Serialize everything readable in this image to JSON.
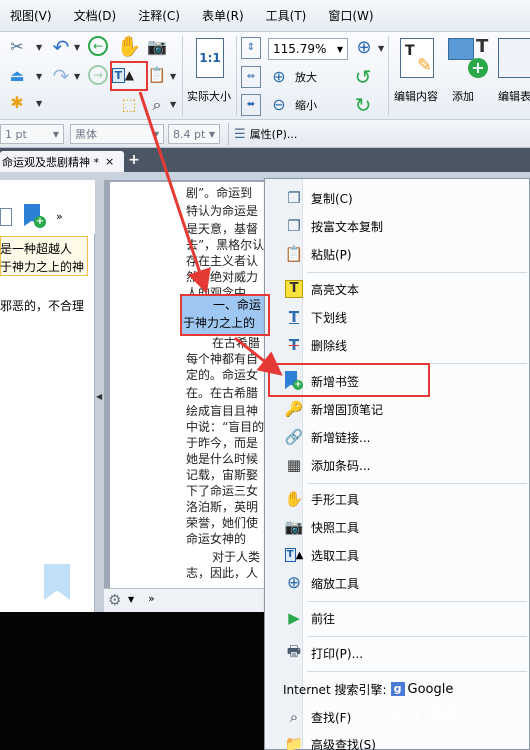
{
  "menubar": {
    "items": [
      "视图(V)",
      "文档(D)",
      "注释(C)",
      "表单(R)",
      "工具(T)",
      "窗口(W)"
    ]
  },
  "ribbon": {
    "actual_size_label": "实际大小",
    "zoom_value": "115.79%",
    "zoom_in_label": "放大",
    "zoom_out_label": "缩小",
    "edit_content_label": "编辑内容",
    "add_label": "添加",
    "edit_form_label": "编辑表",
    "actual_size_icon_text": "1:1"
  },
  "fontbar": {
    "size1": "1 pt",
    "font_name": "黑体",
    "size2": "8.4 pt",
    "properties_label": "属性(P)..."
  },
  "tab": {
    "title": "命运观及悲剧精神 *",
    "close": "×",
    "new": "+"
  },
  "bookmarks": {
    "line1": "是一种超越人",
    "line2": "于神力之上的神",
    "line3": "邪恶的，不合理"
  },
  "document": {
    "lines_top": [
      "剧”。命运到",
      "特认为命运是",
      "是天意，基督",
      "去”，黑格尔认",
      "存在主义者认",
      "然的绝对威力",
      "人的观念中。"
    ],
    "highlight": [
      "一、命运",
      "于神力之上的"
    ],
    "lines_bottom": [
      "在古希腊",
      "每个神都有自",
      "定的。命运女",
      "在。在古希腊",
      "绘成盲目且神",
      "中说：“盲目的",
      "于昨今，而是",
      "她是什么时候",
      "记载，宙斯娶",
      "下了命运三女",
      "洛泊斯，英明",
      "荣誉，她们使",
      "命运女神的",
      "对于人类",
      "志，因此，人"
    ]
  },
  "context_menu": {
    "items": [
      {
        "label": "复制(C)",
        "icon": "copy-icon"
      },
      {
        "label": "按富文本复制",
        "icon": "rich-copy-icon"
      },
      {
        "label": "粘贴(P)",
        "icon": "paste-icon"
      },
      {
        "label": "高亮文本",
        "icon": "highlight-icon"
      },
      {
        "label": "下划线",
        "icon": "underline-icon"
      },
      {
        "label": "删除线",
        "icon": "strikeout-icon"
      },
      {
        "label": "新增书签",
        "icon": "add-bookmark-icon"
      },
      {
        "label": "新增固顶笔记",
        "icon": "pin-note-icon"
      },
      {
        "label": "新增链接...",
        "icon": "add-link-icon"
      },
      {
        "label": "添加条码...",
        "icon": "barcode-icon"
      },
      {
        "label": "手形工具",
        "icon": "hand-icon"
      },
      {
        "label": "快照工具",
        "icon": "camera-icon"
      },
      {
        "label": "选取工具",
        "icon": "select-icon"
      },
      {
        "label": "缩放工具",
        "icon": "zoom-icon"
      },
      {
        "label": "前往",
        "icon": "goto-icon"
      },
      {
        "label": "打印(P)...",
        "icon": "printer-icon"
      },
      {
        "label": "查找(F)",
        "icon": "find-icon"
      },
      {
        "label": "高级查找(S)",
        "icon": "advanced-find-icon"
      }
    ],
    "search_engine_label": "Internet 搜索引擎:",
    "search_engine_name": "Google",
    "search_engine_badge": "g"
  },
  "watermark": "Bai 经验",
  "colors": {
    "annotation_red": "#e53935",
    "selection_blue": "#9ec7f2",
    "tab_bar": "#4c5563"
  }
}
